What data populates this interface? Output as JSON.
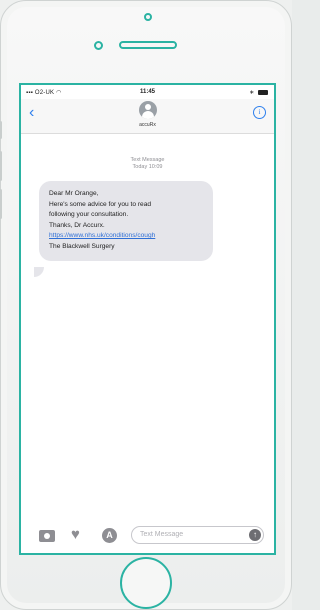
{
  "status_bar": {
    "carrier": "O2-UK",
    "time": "11:45"
  },
  "header": {
    "back_icon": "chevron-left-icon",
    "contact_name": "accuRx",
    "info_icon": "info-icon"
  },
  "conversation": {
    "meta_line1": "Text Message",
    "meta_line2": "Today 10:09",
    "message": {
      "line1": "Dear Mr Orange,",
      "line2": "Here's some advice for you to read",
      "line3": "following your consultation.",
      "line4": "Thanks, Dr Accurx.",
      "link": "https://www.nhs.uk/conditions/cough",
      "line6": "The Blackwell Surgery"
    }
  },
  "compose": {
    "placeholder": "Text Message",
    "icons": [
      "camera-icon",
      "heart-icon",
      "app-store-icon",
      "send-arrow-icon"
    ]
  },
  "colors": {
    "accent": "#2bb3a3",
    "ios_blue": "#2f80ed",
    "bubble": "#e5e5ea"
  }
}
